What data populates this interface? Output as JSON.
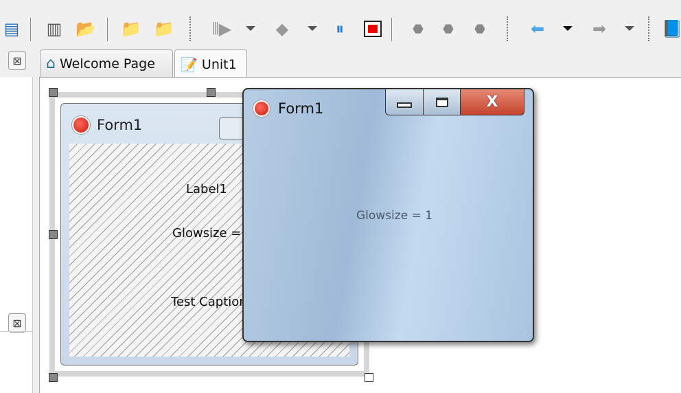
{
  "toolbar": {
    "icons": [
      "save-all-icon",
      "save-icon",
      "open-icon",
      "add-to-project-icon",
      "remove-from-project-icon",
      "run-icon",
      "run-dropdown",
      "build-icon",
      "build-dropdown",
      "pause-icon",
      "stop-icon",
      "step-into-icon",
      "step-over-icon",
      "step-out-icon",
      "back-icon",
      "back-dropdown",
      "forward-icon",
      "forward-dropdown",
      "help-icon"
    ]
  },
  "tabs": [
    {
      "label": "Welcome Page",
      "icon": "home-icon"
    },
    {
      "label": "Unit1",
      "icon": "unit-file-icon",
      "active": true
    }
  ],
  "designer": {
    "form_title": "Form1",
    "label1": "Label1",
    "glowsize_label": "Glowsize =",
    "caption_label": "Test Caption"
  },
  "runtime_window": {
    "title": "Form1",
    "glowsize_text": "Glowsize = 1",
    "close_color": "#c8432e"
  }
}
